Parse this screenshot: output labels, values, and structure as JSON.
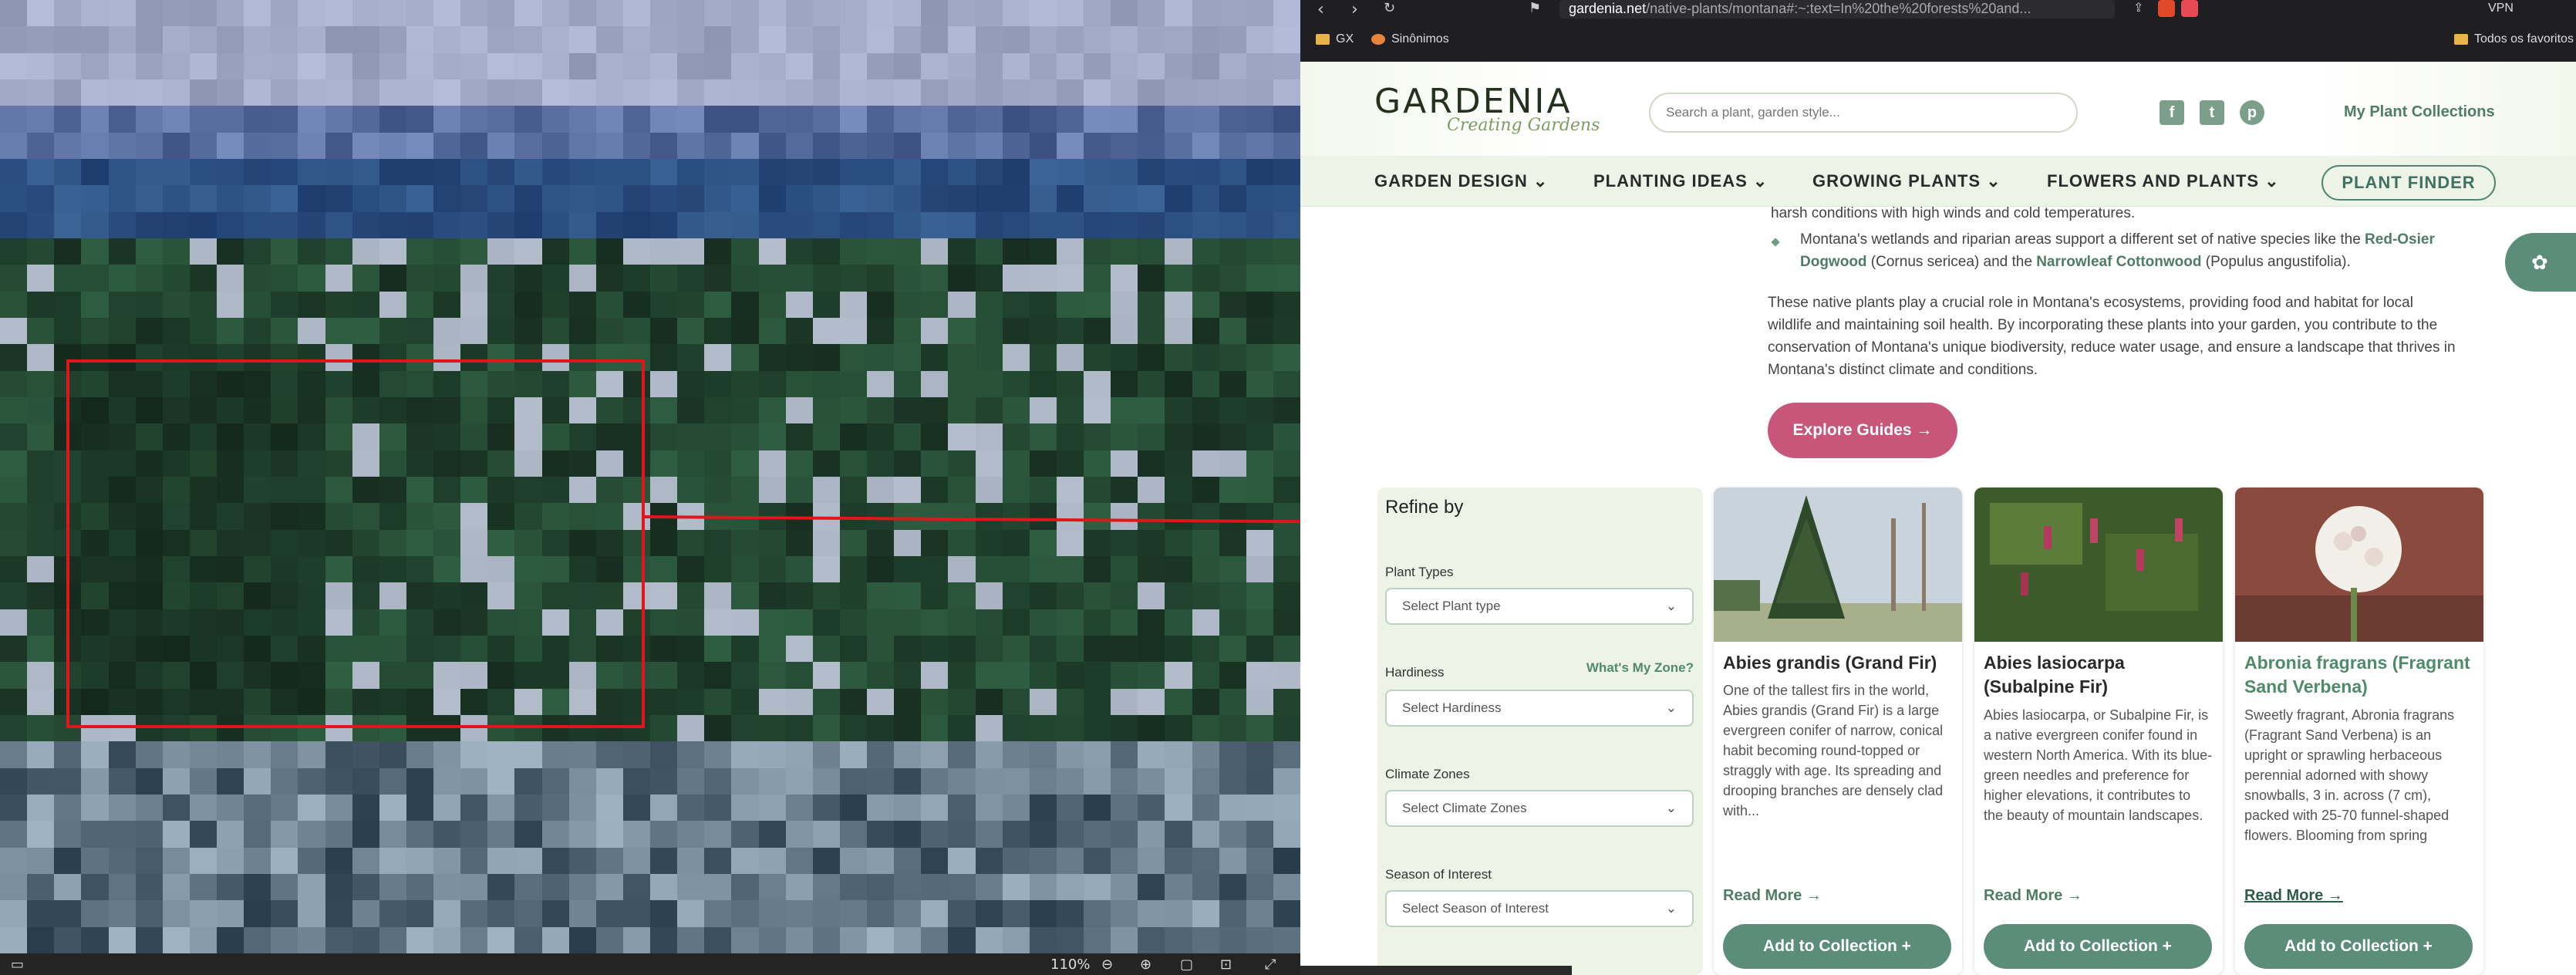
{
  "viewer": {
    "zoom": "110%"
  },
  "browser": {
    "url_domain": "gardenia.net",
    "url_path": "/native-plants/montana#:~:text=In%20the%20forests%20and...",
    "vpn_label": "VPN"
  },
  "bookmarks": {
    "items": [
      "GX",
      "Sinônimos"
    ],
    "all_label": "Todos os favoritos"
  },
  "site": {
    "logo": "GARDENIA",
    "logo_sub": "Creating Gardens",
    "search_placeholder": "Search a plant, garden style...",
    "collection_link": "My Plant Collections"
  },
  "nav": {
    "items": [
      "GARDEN DESIGN",
      "PLANTING IDEAS",
      "GROWING PLANTS",
      "FLOWERS AND PLANTS"
    ],
    "finder": "PLANT FINDER"
  },
  "article": {
    "line_top": "harsh conditions with high winds and cold temperatures.",
    "bullet_a": "Montana's wetlands and riparian areas support a different set of native species like the ",
    "bullet_link1": "Red-Osier",
    "bullet_link1b": "Dogwood",
    "bullet_mid": " (Cornus sericea) and the ",
    "bullet_link2": "Narrowleaf Cottonwood",
    "bullet_end": " (Populus angustifolia).",
    "para_1": "These native plants play a crucial role in Montana's ecosystems, providing food and habitat for local",
    "para_2": "wildlife and maintaining soil health. By incorporating these plants into your garden, you contribute to the",
    "para_3": "conservation of Montana's unique biodiversity, reduce water usage, and ensure a landscape that thrives in",
    "para_4": "Montana's distinct climate and conditions.",
    "cta": "Explore Guides →"
  },
  "filters": {
    "title": "Refine by",
    "plant_types_label": "Plant Types",
    "plant_types_value": "Select Plant type",
    "hardiness_label": "Hardiness",
    "zone_link": "What's My Zone?",
    "hardiness_value": "Select Hardiness",
    "climate_label": "Climate Zones",
    "climate_value": "Select Climate Zones",
    "season_label": "Season of Interest",
    "season_value": "Select Season of Interest"
  },
  "cards": [
    {
      "title": "Abies grandis (Grand Fir)",
      "desc": "One of the tallest firs in the world, Abies grandis (Grand Fir) is a large evergreen conifer of narrow, conical habit becoming round-topped or straggly with age. Its spreading and drooping branches are densely clad with...",
      "more": "Read More →",
      "add": "Add to Collection +"
    },
    {
      "title": "Abies lasiocarpa (Subalpine Fir)",
      "desc": "Abies lasiocarpa, or Subalpine Fir, is a native evergreen conifer found in western North America. With its blue-green needles and preference for higher elevations, it contributes to the beauty of mountain landscapes.",
      "more": "Read More →",
      "add": "Add to Collection +"
    },
    {
      "title": "Abronia fragrans (Fragrant Sand Verbena)",
      "desc": "Sweetly fragrant, Abronia fragrans (Fragrant Sand Verbena) is an upright or sprawling herbaceous perennial adorned with showy snowballs, 3 in. across (7 cm), packed with 25-70 funnel-shaped flowers. Blooming from spring through...",
      "more": "Read More →",
      "add": "Add to Collection +"
    }
  ],
  "colors": {
    "accent_green": "#5b8d7a",
    "cta_pink": "#c7567a",
    "annotation_red": "#e0161b"
  }
}
